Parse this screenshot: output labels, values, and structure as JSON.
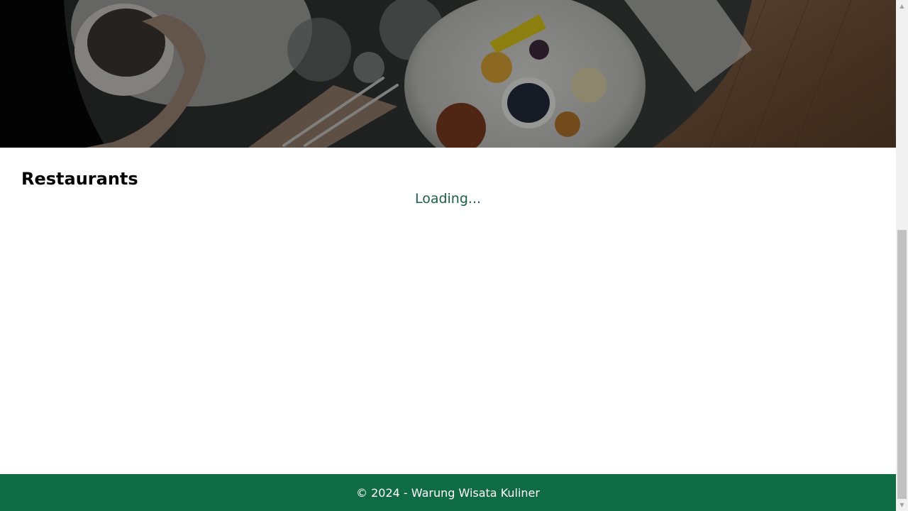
{
  "hero": {
    "image_name": "food-table-photo"
  },
  "main": {
    "section_title": "Restaurants",
    "loading_text": "Loading..."
  },
  "footer": {
    "text": "© 2024 - Warung Wisata Kuliner"
  },
  "scrollbar": {
    "up_icon": "triangle-up-icon",
    "down_icon": "triangle-down-icon",
    "up_glyph": "▲",
    "down_glyph": "▼"
  },
  "colors": {
    "footer_bg": "#0f6b43",
    "loading_text": "#1b6045",
    "title_text": "#000000"
  }
}
